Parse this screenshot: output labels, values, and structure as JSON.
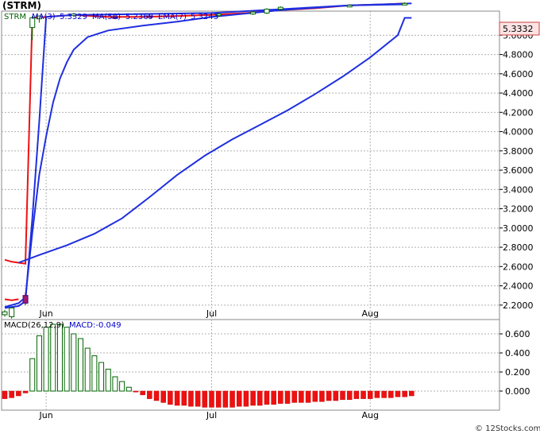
{
  "chart_data": [
    {
      "type": "candlestick",
      "title": "(STRM)",
      "legend": [
        {
          "label": "STRM",
          "color": "#006400"
        },
        {
          "label": "MA(3)",
          "value": "5.3329",
          "color": "#0000cc"
        },
        {
          "label": "MA(50)",
          "value": "5.2369",
          "color": "#0000cc"
        },
        {
          "label": "EMA(7)",
          "value": "5.3243",
          "color": "#0000cc"
        }
      ],
      "last_price_label": "5.3332",
      "ylim": [
        2.05,
        5.25
      ],
      "y_ticks": [
        "5.0000",
        "4.8000",
        "4.6000",
        "4.4000",
        "4.2000",
        "4.0000",
        "3.8000",
        "3.6000",
        "3.4000",
        "3.2000",
        "3.0000",
        "2.8000",
        "2.6000",
        "2.4000",
        "2.2000"
      ],
      "y_tick_values": [
        5.0,
        4.8,
        4.6,
        4.4,
        4.2,
        4.0,
        3.8,
        3.6,
        3.4,
        3.2,
        3.0,
        2.8,
        2.6,
        2.4,
        2.2
      ],
      "x_labels": [
        {
          "label": "Jun",
          "day": 6
        },
        {
          "label": "Jul",
          "day": 30
        },
        {
          "label": "Aug",
          "day": 53
        }
      ],
      "days": 61,
      "candles": [
        {
          "day": 0,
          "o": 2.1,
          "h": 2.15,
          "l": 2.08,
          "c": 2.13
        },
        {
          "day": 1,
          "o": 2.08,
          "h": 2.18,
          "l": 2.06,
          "c": 2.17
        },
        {
          "day": 3,
          "o": 2.3,
          "h": 2.33,
          "l": 2.2,
          "c": 2.22
        },
        {
          "day": 4,
          "o": 5.08,
          "h": 5.2,
          "l": 4.95,
          "c": 5.18
        },
        {
          "day": 5,
          "o": 5.17,
          "h": 5.2,
          "l": 5.13,
          "c": 5.2
        },
        {
          "day": 10,
          "o": 5.21,
          "h": 5.23,
          "l": 5.19,
          "c": 5.22
        },
        {
          "day": 16,
          "o": 5.19,
          "h": 5.21,
          "l": 5.17,
          "c": 5.18
        },
        {
          "day": 21,
          "o": 5.2,
          "h": 5.22,
          "l": 5.18,
          "c": 5.19
        },
        {
          "day": 31,
          "o": 5.21,
          "h": 5.23,
          "l": 5.19,
          "c": 5.22
        },
        {
          "day": 36,
          "o": 5.22,
          "h": 5.25,
          "l": 5.21,
          "c": 5.24
        },
        {
          "day": 38,
          "o": 5.23,
          "h": 5.28,
          "l": 5.22,
          "c": 5.27
        },
        {
          "day": 40,
          "o": 5.27,
          "h": 5.3,
          "l": 5.26,
          "c": 5.29
        },
        {
          "day": 50,
          "o": 5.3,
          "h": 5.32,
          "l": 5.29,
          "c": 5.31
        },
        {
          "day": 58,
          "o": 5.32,
          "h": 5.34,
          "l": 5.31,
          "c": 5.33
        }
      ],
      "series": [
        {
          "name": "MA(3)",
          "color": "#1f2fe0",
          "values": [
            [
              0,
              2.17
            ],
            [
              1,
              2.18
            ],
            [
              2,
              2.19
            ],
            [
              3,
              2.24
            ],
            [
              4,
              3.1
            ],
            [
              5,
              4.1
            ],
            [
              6,
              5.19
            ],
            [
              10,
              5.21
            ],
            [
              20,
              5.22
            ],
            [
              30,
              5.23
            ],
            [
              40,
              5.27
            ],
            [
              50,
              5.31
            ],
            [
              59,
              5.33
            ]
          ]
        },
        {
          "name": "EMA(7)",
          "color": "#1f2fe0",
          "values": [
            [
              0,
              2.18
            ],
            [
              1,
              2.2
            ],
            [
              2,
              2.22
            ],
            [
              3,
              2.28
            ],
            [
              4,
              2.95
            ],
            [
              5,
              3.55
            ],
            [
              6,
              3.95
            ],
            [
              7,
              4.3
            ],
            [
              8,
              4.55
            ],
            [
              9,
              4.72
            ],
            [
              10,
              4.85
            ],
            [
              12,
              4.98
            ],
            [
              15,
              5.05
            ],
            [
              20,
              5.1
            ],
            [
              25,
              5.14
            ],
            [
              30,
              5.19
            ],
            [
              40,
              5.26
            ],
            [
              50,
              5.31
            ],
            [
              58,
              5.32
            ]
          ]
        },
        {
          "name": "MA(50)",
          "color": "#1f2fe0",
          "values": [
            [
              2,
              2.64
            ],
            [
              5,
              2.72
            ],
            [
              9,
              2.82
            ],
            [
              13,
              2.94
            ],
            [
              17,
              3.1
            ],
            [
              21,
              3.32
            ],
            [
              25,
              3.55
            ],
            [
              29,
              3.75
            ],
            [
              33,
              3.92
            ],
            [
              37,
              4.07
            ],
            [
              41,
              4.22
            ],
            [
              45,
              4.39
            ],
            [
              49,
              4.57
            ],
            [
              53,
              4.77
            ],
            [
              57,
              5.0
            ],
            [
              58,
              5.18
            ],
            [
              59,
              5.18
            ]
          ]
        },
        {
          "name": "red",
          "color": "#ee1111",
          "values": [
            [
              0,
              2.67
            ],
            [
              1,
              2.65
            ],
            [
              2,
              2.64
            ],
            [
              3,
              2.63
            ],
            [
              4,
              5.18
            ],
            [
              6,
              5.19
            ],
            [
              10,
              5.21
            ],
            [
              15,
              5.19
            ],
            [
              20,
              5.19
            ],
            [
              25,
              5.2
            ],
            [
              30,
              5.21
            ],
            [
              35,
              5.23
            ],
            [
              40,
              5.26
            ],
            [
              45,
              5.28
            ],
            [
              50,
              5.31
            ],
            [
              55,
              5.32
            ],
            [
              58,
              5.33
            ]
          ]
        }
      ],
      "red_upper_start": [
        [
          0,
          2.26
        ],
        [
          1,
          2.25
        ],
        [
          2,
          2.26
        ]
      ]
    },
    {
      "type": "bar",
      "title": "MACD(26,12,9)",
      "legend": [
        {
          "label": "MACD(26,12,9)",
          "color": "#000"
        },
        {
          "label": "MACD:-0.049",
          "color": "#0000cc"
        }
      ],
      "ylim": [
        -0.2,
        0.75
      ],
      "y_ticks": [
        "0.600",
        "0.400",
        "0.200",
        "0.000"
      ],
      "y_tick_values": [
        0.6,
        0.4,
        0.2,
        0.0
      ],
      "x_labels": [
        {
          "label": "Jun",
          "day": 6
        },
        {
          "label": "Jul",
          "day": 30
        },
        {
          "label": "Aug",
          "day": 53
        }
      ],
      "values": [
        -0.08,
        -0.07,
        -0.05,
        -0.02,
        0.34,
        0.58,
        0.67,
        0.7,
        0.7,
        0.67,
        0.6,
        0.55,
        0.45,
        0.37,
        0.3,
        0.23,
        0.15,
        0.1,
        0.04,
        -0.01,
        -0.04,
        -0.08,
        -0.1,
        -0.12,
        -0.14,
        -0.15,
        -0.15,
        -0.16,
        -0.16,
        -0.17,
        -0.17,
        -0.17,
        -0.17,
        -0.17,
        -0.16,
        -0.16,
        -0.15,
        -0.15,
        -0.14,
        -0.14,
        -0.13,
        -0.13,
        -0.12,
        -0.12,
        -0.12,
        -0.11,
        -0.11,
        -0.1,
        -0.1,
        -0.09,
        -0.09,
        -0.08,
        -0.08,
        -0.08,
        -0.07,
        -0.07,
        -0.07,
        -0.06,
        -0.06,
        -0.05
      ]
    }
  ],
  "footer": "© 12Stocks.com"
}
